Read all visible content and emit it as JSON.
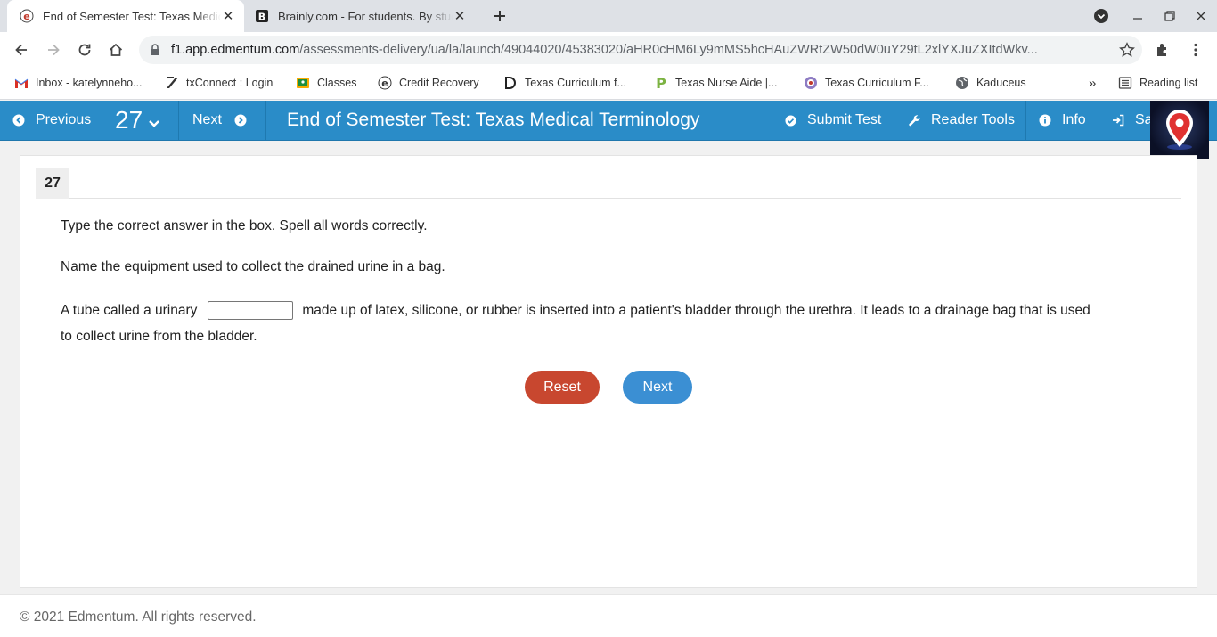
{
  "browser": {
    "tabs": [
      {
        "title": "End of Semester Test: Texas Medical Terminology",
        "favicon": "edmentum-icon",
        "active": true
      },
      {
        "title": "Brainly.com - For students. By students.",
        "favicon": "brainly-icon",
        "active": false
      }
    ],
    "url_host": "f1.app.edmentum.com",
    "url_path": "/assessments-delivery/ua/la/launch/49044020/45383020/aHR0cHM6Ly9mMS5hcHAuZWRtZW50dW0uY29tL2xlYXJuZXItdWkv...",
    "bookmarks": [
      {
        "label": "Inbox - katelynneho...",
        "icon": "gmail-icon"
      },
      {
        "label": "txConnect : Login",
        "icon": "txconnect-icon"
      },
      {
        "label": "Classes",
        "icon": "classes-icon"
      },
      {
        "label": "Credit Recovery",
        "icon": "edmentum-icon"
      },
      {
        "label": "Texas Curriculum f...",
        "icon": "d-icon"
      },
      {
        "label": "Texas Nurse Aide |...",
        "icon": "p-icon"
      },
      {
        "label": "Texas Curriculum F...",
        "icon": "circle-icon"
      },
      {
        "label": "Kaduceus",
        "icon": "globe-icon"
      }
    ],
    "overflow": "»",
    "reading_list": "Reading list"
  },
  "appbar": {
    "previous": "Previous",
    "question_number": "27",
    "next": "Next",
    "title": "End of Semester Test: Texas Medical Terminology",
    "submit": "Submit Test",
    "reader_tools": "Reader Tools",
    "info": "Info",
    "save": "Save"
  },
  "question": {
    "number": "27",
    "instruction": "Type the correct answer in the box. Spell all words correctly.",
    "prompt": "Name the equipment used to collect the drained urine in a bag.",
    "sentence_before": "A tube called a urinary",
    "answer_value": "",
    "sentence_after_line1": "made up of latex, silicone, or rubber is inserted into a patient's bladder through the urethra. It leads to a drainage bag that is used",
    "sentence_after_line2": "to collect urine from the bladder."
  },
  "buttons": {
    "reset": "Reset",
    "next": "Next"
  },
  "footer": {
    "copyright": "© 2021 Edmentum. All rights reserved."
  },
  "colors": {
    "appbar": "#2a8cc8",
    "reset": "#c8472f",
    "next": "#3b8fd3"
  }
}
